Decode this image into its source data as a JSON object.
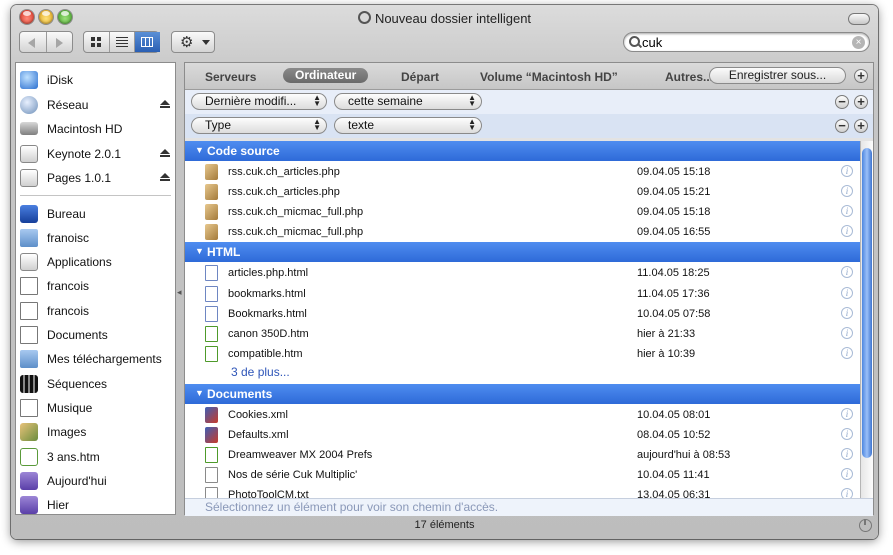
{
  "window": {
    "title": "Nouveau dossier intelligent"
  },
  "search": {
    "value": "cuk"
  },
  "sidebar": {
    "devices": [
      {
        "label": "iDisk",
        "icon": "idisk-icon",
        "eject": false
      },
      {
        "label": "Réseau",
        "icon": "network-globe-icon",
        "eject": true
      },
      {
        "label": "Macintosh HD",
        "icon": "hard-drive-icon",
        "eject": false
      },
      {
        "label": "Keynote 2.0.1",
        "icon": "disk-image-icon",
        "eject": true
      },
      {
        "label": "Pages 1.0.1",
        "icon": "disk-image-icon",
        "eject": true
      }
    ],
    "places": [
      {
        "label": "Bureau",
        "icon": "desktop-icon"
      },
      {
        "label": "franoisc",
        "icon": "home-icon"
      },
      {
        "label": "Applications",
        "icon": "applications-icon"
      },
      {
        "label": "francois",
        "icon": "user-icon"
      },
      {
        "label": "francois",
        "icon": "user-icon"
      },
      {
        "label": "Documents",
        "icon": "document-icon"
      },
      {
        "label": "Mes téléchargements",
        "icon": "folder-icon"
      },
      {
        "label": "Séquences",
        "icon": "movies-icon"
      },
      {
        "label": "Musique",
        "icon": "music-icon"
      },
      {
        "label": "Images",
        "icon": "pictures-icon"
      },
      {
        "label": "3 ans.htm",
        "icon": "html-file-icon"
      },
      {
        "label": "Aujourd'hui",
        "icon": "smart-folder-icon"
      },
      {
        "label": "Hier",
        "icon": "smart-folder-icon"
      }
    ]
  },
  "scope": {
    "items": [
      "Serveurs",
      "Ordinateur",
      "Départ",
      "Volume “Macintosh HD”",
      "Autres..."
    ],
    "active": "Ordinateur",
    "save_label": "Enregistrer sous..."
  },
  "criteria": [
    {
      "field": "Dernière modifi...",
      "value": "cette semaine"
    },
    {
      "field": "Type",
      "value": "texte"
    }
  ],
  "groups": [
    {
      "label": "Code source",
      "rows": [
        {
          "name": "rss.cuk.ch_articles.php",
          "date": "09.04.05 15:18",
          "icon": "php-file-icon"
        },
        {
          "name": "rss.cuk.ch_articles.php",
          "date": "09.04.05 15:21",
          "icon": "php-file-icon"
        },
        {
          "name": "rss.cuk.ch_micmac_full.php",
          "date": "09.04.05 15:18",
          "icon": "php-file-icon"
        },
        {
          "name": "rss.cuk.ch_micmac_full.php",
          "date": "09.04.05 16:55",
          "icon": "php-file-icon"
        }
      ]
    },
    {
      "label": "HTML",
      "rows": [
        {
          "name": "articles.php.html",
          "date": "11.04.05 18:25",
          "icon": "html-file-icon"
        },
        {
          "name": "bookmarks.html",
          "date": "11.04.05 17:36",
          "icon": "html-file-icon"
        },
        {
          "name": "Bookmarks.html",
          "date": "10.04.05 07:58",
          "icon": "html-file-icon"
        },
        {
          "name": "canon 350D.htm",
          "date": "hier à 21:33",
          "icon": "dreamweaver-file-icon"
        },
        {
          "name": "compatible.htm",
          "date": "hier à 10:39",
          "icon": "dreamweaver-file-icon"
        }
      ],
      "more": "3 de plus..."
    },
    {
      "label": "Documents",
      "rows": [
        {
          "name": "Cookies.xml",
          "date": "10.04.05 08:01",
          "icon": "xml-file-icon"
        },
        {
          "name": "Defaults.xml",
          "date": "08.04.05 10:52",
          "icon": "xml-file-icon"
        },
        {
          "name": "Dreamweaver MX 2004 Prefs",
          "date": "aujourd'hui à 08:53",
          "icon": "dreamweaver-file-icon"
        },
        {
          "name": "Nos de série Cuk Multiplic'",
          "date": "10.04.05 11:41",
          "icon": "text-file-icon"
        },
        {
          "name": "PhotoToolCM.txt",
          "date": "13.04.05 06:31",
          "icon": "text-file-icon"
        }
      ]
    }
  ],
  "pathbar": {
    "text": "Sélectionnez un élément pour voir son chemin d'accès."
  },
  "status": {
    "count": "17 éléments"
  }
}
